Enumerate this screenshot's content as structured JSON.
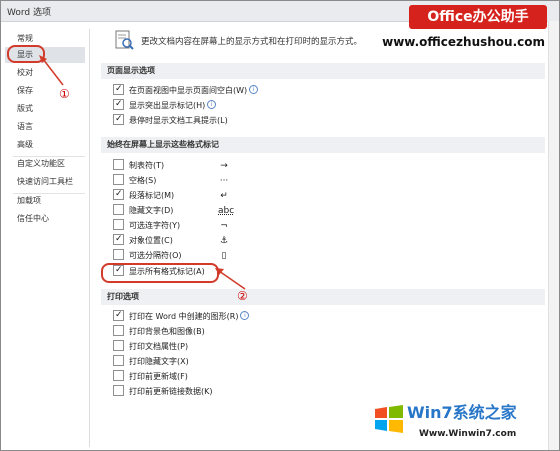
{
  "window": {
    "title": "Word 选项"
  },
  "watermark": {
    "brand": "Office办公助手",
    "url": "www.officezhushou.com"
  },
  "sidebar": {
    "items": [
      {
        "label": "常规"
      },
      {
        "label": "显示"
      },
      {
        "label": "校对"
      },
      {
        "label": "保存"
      },
      {
        "label": "版式"
      },
      {
        "label": "语言"
      },
      {
        "label": "高级"
      },
      {
        "label": "自定义功能区"
      },
      {
        "label": "快速访问工具栏"
      },
      {
        "label": "加载项"
      },
      {
        "label": "信任中心"
      }
    ]
  },
  "main": {
    "intro": "更改文档内容在屏幕上的显示方式和在打印时的显示方式。",
    "sections": {
      "page": {
        "title": "页面显示选项",
        "items": [
          {
            "label": "在页面视图中显示页面间空白(W)",
            "checked": true,
            "info": "i"
          },
          {
            "label": "显示突出显示标记(H)",
            "checked": true,
            "info": "i"
          },
          {
            "label": "悬停时显示文档工具提示(L)",
            "checked": true
          }
        ]
      },
      "marks": {
        "title": "始终在屏幕上显示这些格式标记",
        "items": [
          {
            "label": "制表符(T)",
            "checked": false,
            "glyph": "→"
          },
          {
            "label": "空格(S)",
            "checked": false,
            "glyph": "···"
          },
          {
            "label": "段落标记(M)",
            "checked": true,
            "glyph": "↵"
          },
          {
            "label": "隐藏文字(D)",
            "checked": false,
            "glyph": "abc"
          },
          {
            "label": "可选连字符(Y)",
            "checked": false,
            "glyph": "¬"
          },
          {
            "label": "对象位置(C)",
            "checked": true,
            "glyph": "⚓"
          },
          {
            "label": "可选分隔符(O)",
            "checked": false,
            "glyph": "▯"
          },
          {
            "label": "显示所有格式标记(A)",
            "checked": true
          }
        ]
      },
      "print": {
        "title": "打印选项",
        "items": [
          {
            "label": "打印在 Word 中创建的图形(R)",
            "checked": true,
            "info": "i"
          },
          {
            "label": "打印背景色和图像(B)",
            "checked": false
          },
          {
            "label": "打印文档属性(P)",
            "checked": false
          },
          {
            "label": "打印隐藏文字(X)",
            "checked": false
          },
          {
            "label": "打印前更新域(F)",
            "checked": false
          },
          {
            "label": "打印前更新链接数据(K)",
            "checked": false
          }
        ]
      }
    }
  },
  "annotations": {
    "marker1": "①",
    "marker2": "②"
  },
  "footer_watermark": {
    "name": "Win7系统之家",
    "url": "Www.Winwin7.com"
  },
  "colors": {
    "brand_red": "#d6221c",
    "annotation_red": "#d23a2a"
  }
}
